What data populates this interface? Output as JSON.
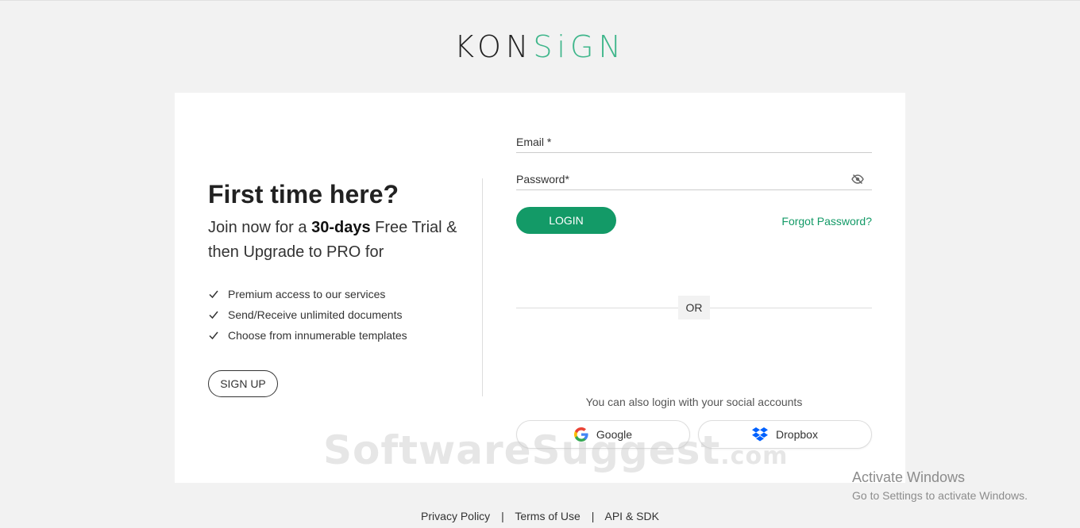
{
  "brand": {
    "logo_dark": "KON",
    "logo_green": "SiGN"
  },
  "left": {
    "heading": "First time here?",
    "subtitle_pre": "Join now for a ",
    "subtitle_bold": "30-days",
    "subtitle_post": " Free Trial & then Upgrade to PRO for",
    "features": [
      "Premium access to our services",
      "Send/Receive unlimited documents",
      "Choose from innumerable templates"
    ],
    "signup_label": "SIGN UP"
  },
  "form": {
    "email_label": "Email *",
    "email_value": "",
    "password_label": "Password*",
    "password_value": "",
    "login_label": "LOGIN",
    "forgot_label": "Forgot Password?",
    "or_label": "OR",
    "social_text": "You can also login with your social accounts",
    "google_label": "Google",
    "dropbox_label": "Dropbox"
  },
  "watermark": {
    "main": "SoftwareSuggest",
    "suffix": ".com"
  },
  "activation": {
    "title": "Activate Windows",
    "subtitle": "Go to Settings to activate Windows."
  },
  "footer": {
    "links": [
      "Privacy Policy",
      "Terms of Use",
      "API & SDK"
    ],
    "separator": "|"
  },
  "colors": {
    "accent": "#139a67",
    "logo_green": "#3fb68b"
  },
  "icons": {
    "check": "check-icon",
    "eye": "eye-off-icon",
    "google": "google-icon",
    "dropbox": "dropbox-icon"
  }
}
